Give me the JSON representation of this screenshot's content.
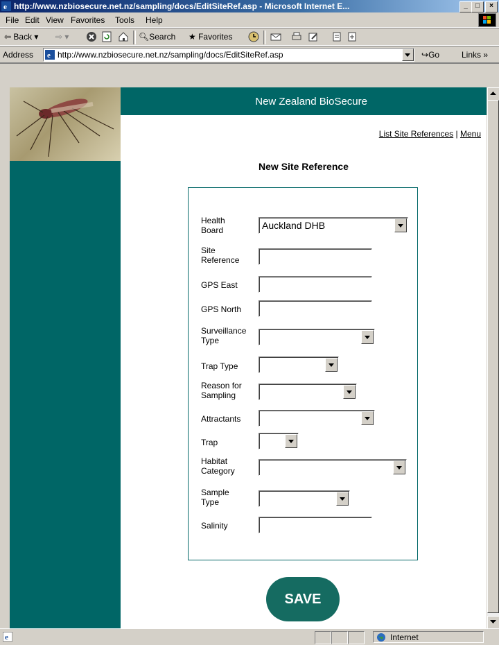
{
  "window": {
    "title": "http://www.nzbiosecure.net.nz/sampling/docs/EditSiteRef.asp - Microsoft Internet E...",
    "controls": [
      "_",
      "□",
      "×"
    ]
  },
  "menu": [
    "File",
    "Edit",
    "View",
    "Favorites",
    "Tools",
    "Help"
  ],
  "toolbar": {
    "back": "Back",
    "search": "Search",
    "favorites": "Favorites"
  },
  "address": {
    "label": "Address",
    "url": "http://www.nzbiosecure.net.nz/sampling/docs/EditSiteRef.asp",
    "go": "Go",
    "links": "Links »"
  },
  "page": {
    "brand": "New Zealand BioSecure",
    "nav_list": "List Site References",
    "nav_menu": "Menu",
    "title": "New Site Reference",
    "form": {
      "health_board_label": "Health Board",
      "health_board_value": "Auckland DHB",
      "site_reference_label": "Site Reference",
      "gps_east_label": "GPS East",
      "gps_north_label": "GPS North",
      "surveillance_type_label": "Surveillance Type",
      "trap_type_label": "Trap Type",
      "reason_label": "Reason for Sampling",
      "attractants_label": "Attractants",
      "trap_label": "Trap",
      "habitat_label": "Habitat Category",
      "sample_type_label": "Sample Type",
      "salinity_label": "Salinity"
    },
    "save": "SAVE"
  },
  "status": {
    "zone": "Internet"
  },
  "colors": {
    "teal": "#006666",
    "button": "#156b61"
  }
}
